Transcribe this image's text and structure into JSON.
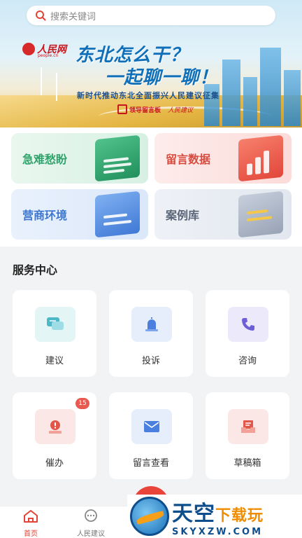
{
  "search": {
    "placeholder": "搜索关键词",
    "icon": "search-icon"
  },
  "banner": {
    "logo_text": "人民网",
    "logo_sub": "people.cn",
    "headline_1": "东北怎么干？",
    "headline_2": "一起聊一聊！",
    "subtitle": "新时代推动东北全面振兴人民建议征集",
    "partner_1": "领导留言板",
    "partner_2": "人民建议"
  },
  "quick_cards": [
    {
      "label": "急难愁盼",
      "icon": "clipboard-icon",
      "color": "#2fa36b"
    },
    {
      "label": "留言数据",
      "icon": "chart-icon",
      "color": "#d84b3e"
    },
    {
      "label": "营商环境",
      "icon": "handshake-icon",
      "color": "#3d76cf"
    },
    {
      "label": "案例库",
      "icon": "document-tray-icon",
      "color": "#5a6578"
    }
  ],
  "service": {
    "title": "服务中心",
    "items": [
      {
        "label": "建议",
        "icon": "chat-bubble-icon"
      },
      {
        "label": "投诉",
        "icon": "alarm-light-icon"
      },
      {
        "label": "咨询",
        "icon": "phone-icon"
      },
      {
        "label": "催办",
        "icon": "urge-alert-icon",
        "badge": "15"
      },
      {
        "label": "留言查看",
        "icon": "envelope-icon"
      },
      {
        "label": "草稿箱",
        "icon": "drafts-tray-icon"
      }
    ]
  },
  "tabbar": {
    "items": [
      {
        "label": "首页",
        "icon": "home-icon",
        "active": true
      },
      {
        "label": "人民建议",
        "icon": "message-dots-icon",
        "active": false
      }
    ]
  },
  "watermark": {
    "title_a": "天空",
    "title_b": "下载玩",
    "url": "SKYXZW.COM"
  }
}
